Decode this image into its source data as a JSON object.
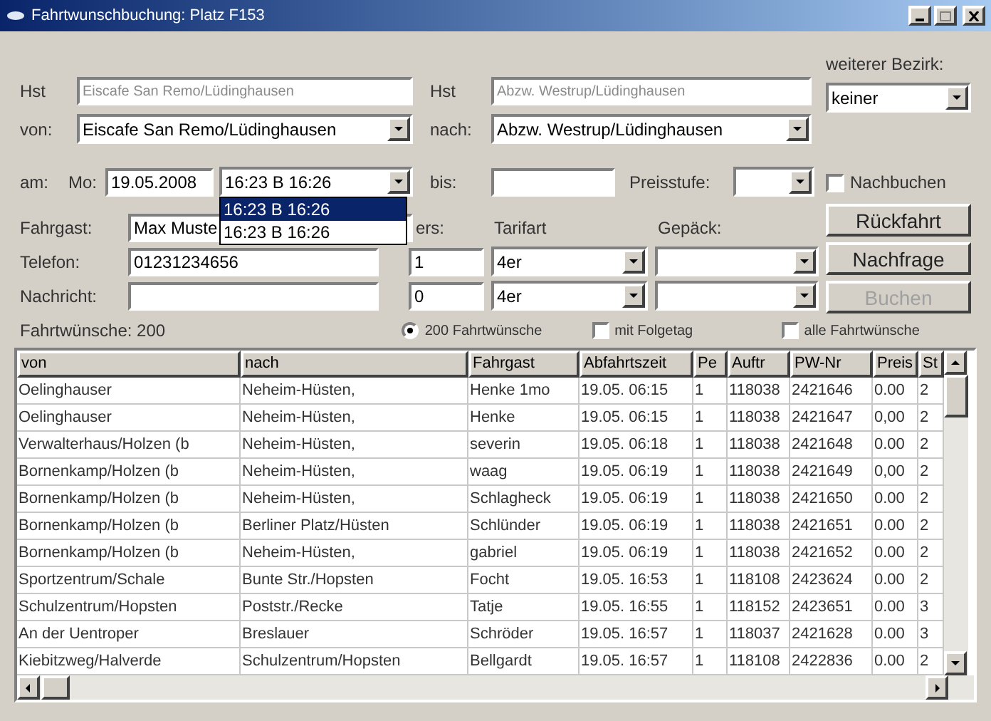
{
  "window": {
    "title": "Fahrtwunschbuchung: Platz F153"
  },
  "from": {
    "hst_label": "Hst",
    "hst_value": "Eiscafe San Remo/Lüdinghausen",
    "label": "von:",
    "value": "Eiscafe San Remo/Lüdinghausen"
  },
  "to": {
    "hst_label": "Hst",
    "hst_value": "Abzw. Westrup/Lüdinghausen",
    "label": "nach:",
    "value": "Abzw. Westrup/Lüdinghausen"
  },
  "date": {
    "label": "am:",
    "weekday": "Mo:",
    "value": "19.05.2008",
    "time": "16:23 B 16:26",
    "time_options": [
      {
        "label": "16:23 B 16:26",
        "selected": true
      },
      {
        "label": "16:23 B 16:26",
        "selected": false
      }
    ]
  },
  "until": {
    "label": "bis:"
  },
  "price_level": {
    "label": "Preisstufe:"
  },
  "passenger": {
    "label": "Fahrgast:",
    "value": "Max Muste"
  },
  "phone": {
    "label": "Telefon:",
    "value": "01231234656"
  },
  "message": {
    "label": "Nachricht:"
  },
  "persons": {
    "label": "ers:",
    "values": [
      "1",
      "0"
    ]
  },
  "tariff": {
    "label": "Tarifart",
    "values": [
      "4er",
      "4er"
    ]
  },
  "luggage": {
    "label": "Gepäck:"
  },
  "district": {
    "label": "weiterer Bezirk:",
    "value": "keiner"
  },
  "rebook": {
    "label": "Nachbuchen",
    "checked": false
  },
  "buttons": [
    {
      "label": "Rückfahrt",
      "disabled": false
    },
    {
      "label": "Nachfrage",
      "disabled": false
    },
    {
      "label": "Buchen",
      "disabled": true
    }
  ],
  "summary": "Fahrtwünsche: 200",
  "filters": [
    {
      "kind": "radio",
      "label": "200 Fahrtwünsche",
      "checked": true
    },
    {
      "kind": "checkbox",
      "label": "mit Folgetag",
      "checked": false
    },
    {
      "kind": "checkbox",
      "label": "alle Fahrtwünsche",
      "checked": false
    }
  ],
  "table": {
    "columns": [
      "von",
      "nach",
      "Fahrgast",
      "Abfahrtszeit",
      "Pe",
      "Auftr",
      "PW-Nr",
      "Preis",
      "St"
    ],
    "rows": [
      [
        "Oelinghauser",
        "Neheim-Hüsten,",
        "Henke 1mo",
        "19.05. 06:15",
        "1",
        "118038",
        "2421646",
        "0.00",
        "2"
      ],
      [
        "Oelinghauser",
        "Neheim-Hüsten,",
        "Henke",
        "19.05. 06:15",
        "1",
        "118038",
        "2421647",
        "0,00",
        "2"
      ],
      [
        "Verwalterhaus/Holzen (b",
        "Neheim-Hüsten,",
        "severin",
        "19.05. 06:18",
        "1",
        "118038",
        "2421648",
        "0.00",
        "2"
      ],
      [
        "Bornenkamp/Holzen (b",
        "Neheim-Hüsten,",
        "waag",
        "19.05. 06:19",
        "1",
        "118038",
        "2421649",
        "0,00",
        "2"
      ],
      [
        "Bornenkamp/Holzen (b",
        "Neheim-Hüsten,",
        "Schlagheck",
        "19.05. 06:19",
        "1",
        "118038",
        "2421650",
        "0.00",
        "2"
      ],
      [
        "Bornenkamp/Holzen (b",
        "Berliner Platz/Hüsten",
        "Schlünder",
        "19.05. 06:19",
        "1",
        "118038",
        "2421651",
        "0.00",
        "2"
      ],
      [
        "Bornenkamp/Holzen (b",
        "Neheim-Hüsten,",
        "gabriel",
        "19.05. 06:19",
        "1",
        "118038",
        "2421652",
        "0.00",
        "2"
      ],
      [
        "Sportzentrum/Schale",
        "Bunte Str./Hopsten",
        "Focht",
        "19.05. 16:53",
        "1",
        "118108",
        "2423624",
        "0.00",
        "2"
      ],
      [
        "Schulzentrum/Hopsten",
        "Poststr./Recke",
        "Tatje",
        "19.05. 16:55",
        "1",
        "118152",
        "2423651",
        "0.00",
        "3"
      ],
      [
        "An der Uentroper",
        "Breslauer",
        "Schröder",
        "19.05. 16:57",
        "1",
        "118037",
        "2421628",
        "0.00",
        "3"
      ],
      [
        "Kiebitzweg/Halverde",
        "Schulzentrum/Hopsten",
        "Bellgardt",
        "19.05. 16:57",
        "1",
        "118108",
        "2422836",
        "0.00",
        "2"
      ]
    ]
  }
}
